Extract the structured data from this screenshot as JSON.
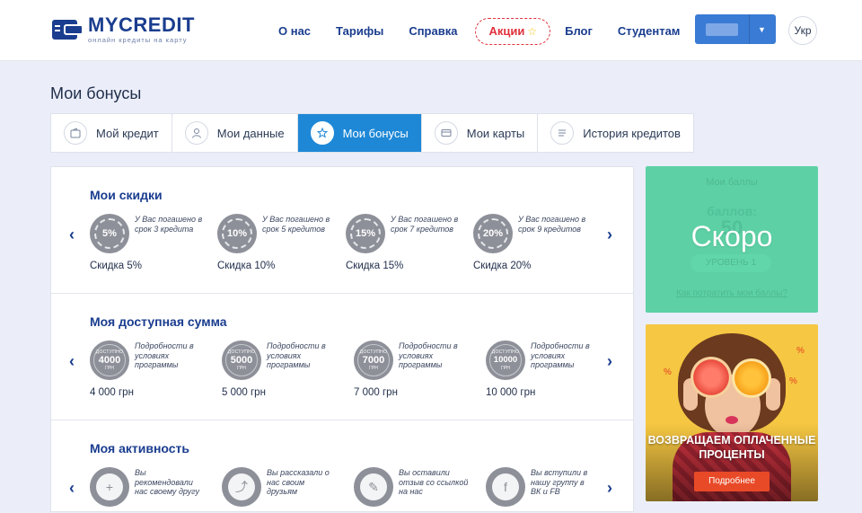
{
  "header": {
    "logo_name": "MYCREDIT",
    "logo_tagline": "онлайн кредиты на карту",
    "nav": [
      "О нас",
      "Тарифы",
      "Справка",
      "Акции",
      "Блог",
      "Студентам"
    ],
    "promo_star": "☆",
    "lang": "Укр"
  },
  "page": {
    "title": "Мои бонусы"
  },
  "tabs": [
    {
      "label": "Мой кредит",
      "icon": "wallet-icon"
    },
    {
      "label": "Мои данные",
      "icon": "user-icon"
    },
    {
      "label": "Мои бонусы",
      "icon": "star-icon",
      "active": true
    },
    {
      "label": "Мои карты",
      "icon": "card-icon"
    },
    {
      "label": "История кредитов",
      "icon": "list-icon"
    }
  ],
  "discounts": {
    "title": "Мои скидки",
    "items": [
      {
        "badge": "5%",
        "desc": "У Вас погашено в срок 3 кредита",
        "label": "Скидка 5%"
      },
      {
        "badge": "10%",
        "desc": "У Вас погашено в срок 5 кредитов",
        "label": "Скидка 10%"
      },
      {
        "badge": "15%",
        "desc": "У Вас погашено в срок 7 кредитов",
        "label": "Скидка 15%"
      },
      {
        "badge": "20%",
        "desc": "У Вас погашено в срок 9 кредитов",
        "label": "Скидка 20%"
      }
    ]
  },
  "available": {
    "title": "Моя доступная сумма",
    "badge_top": "ДОСТУПНО",
    "badge_cur": "ГРН",
    "items": [
      {
        "amount": "4000",
        "desc": "Подробности в условиях программы",
        "label": "4 000 грн"
      },
      {
        "amount": "5000",
        "desc": "Подробности в условиях программы",
        "label": "5 000 грн"
      },
      {
        "amount": "7000",
        "desc": "Подробности в условиях программы",
        "label": "7 000 грн"
      },
      {
        "amount": "10000",
        "desc": "Подробности в условиях программы",
        "label": "10 000 грн"
      }
    ]
  },
  "activity": {
    "title": "Моя активность",
    "items": [
      {
        "icon": "add-user-icon",
        "glyph": "+",
        "desc": "Вы рекомендовали нас своему другу"
      },
      {
        "icon": "share-icon",
        "glyph": "⤴",
        "desc": "Вы рассказали о нас своим друзьям"
      },
      {
        "icon": "pencil-icon",
        "glyph": "✎",
        "desc": "Вы оставили отзыв со ссылкой на нас"
      },
      {
        "icon": "social-group-icon",
        "glyph": "f",
        "desc": "Вы вступили в нашу группу в ВК и FB"
      }
    ]
  },
  "score": {
    "title": "Мои баллы",
    "sub": "баллов:",
    "num": "50",
    "level": "УРОВЕНЬ 1",
    "link": "Как потратить мои баллы?",
    "overlay": "Скоро"
  },
  "promo": {
    "title": "ВОЗВРАЩАЕМ ОПЛАЧЕННЫЕ ПРОЦЕНТЫ",
    "button": "Подробнее"
  },
  "colors": {
    "accent": "#1e88d6",
    "brand": "#1a3d8f",
    "score_bg": "#5dd1a5",
    "promo_btn": "#e84a27"
  }
}
